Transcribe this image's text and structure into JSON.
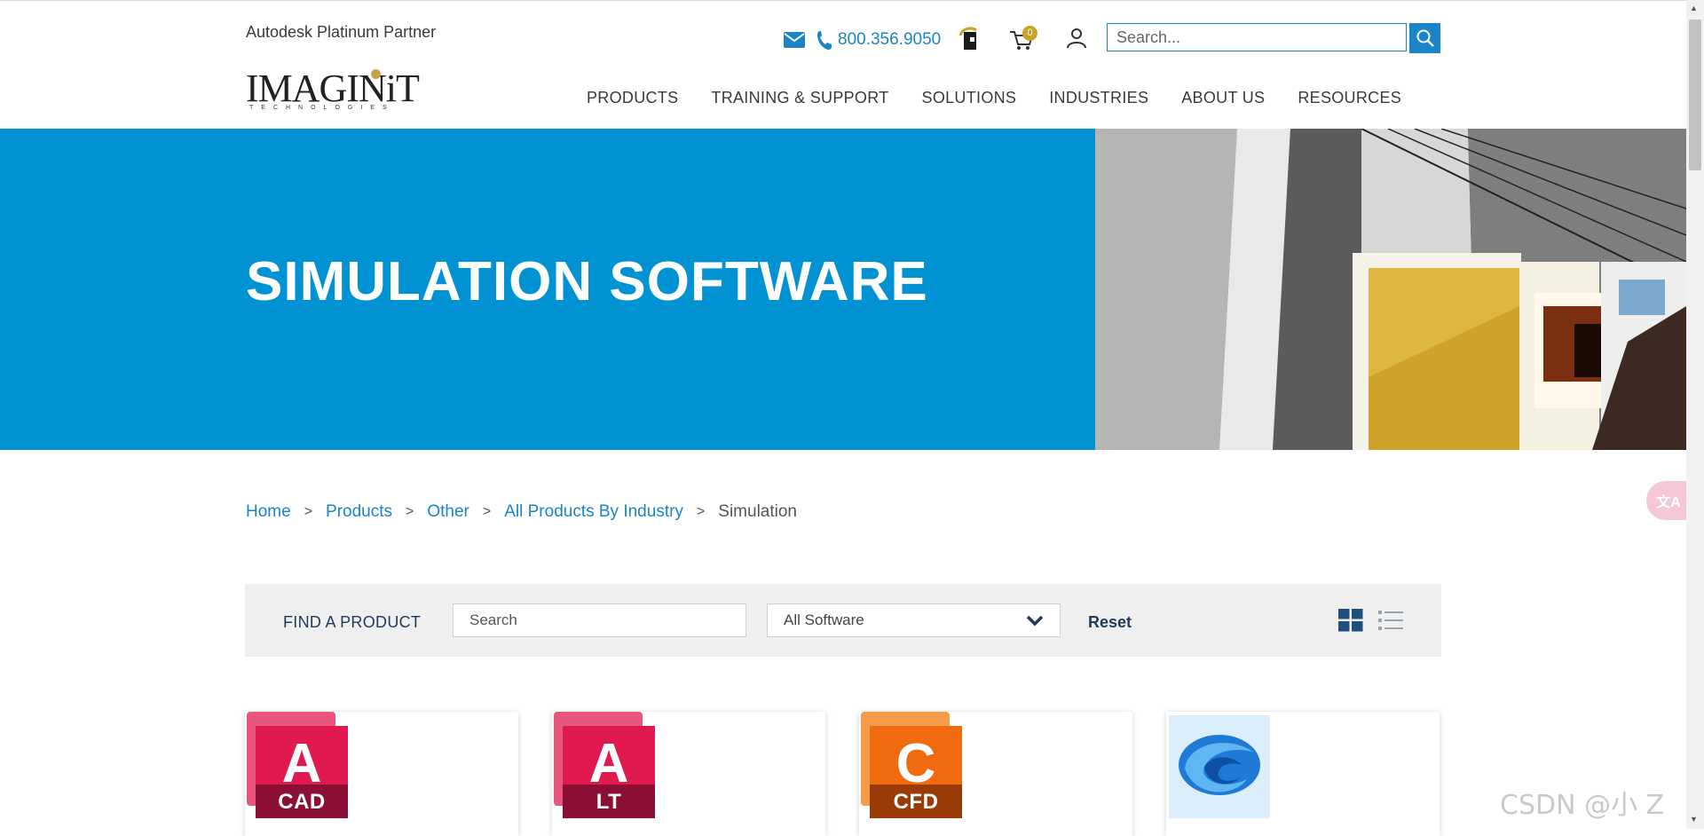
{
  "header": {
    "partner_text": "Autodesk Platinum Partner",
    "logo_text": "IMAGINiT",
    "logo_subtext": "TECHNOLOGIES",
    "phone": "800.356.9050",
    "cart_count": "0",
    "search_placeholder": "Search..."
  },
  "nav": {
    "items": [
      {
        "label": "PRODUCTS"
      },
      {
        "label": "TRAINING & SUPPORT"
      },
      {
        "label": "SOLUTIONS"
      },
      {
        "label": "INDUSTRIES"
      },
      {
        "label": "ABOUT US"
      },
      {
        "label": "RESOURCES"
      }
    ]
  },
  "hero": {
    "title": "SIMULATION SOFTWARE",
    "background_color": "#0192d3"
  },
  "breadcrumb": {
    "items": [
      {
        "label": "Home"
      },
      {
        "label": "Products"
      },
      {
        "label": "Other"
      },
      {
        "label": "All Products By Industry"
      }
    ],
    "current": "Simulation"
  },
  "filter": {
    "label": "FIND A PRODUCT",
    "search_placeholder": "Search",
    "select_value": "All Software",
    "reset_label": "Reset"
  },
  "products": [
    {
      "letter": "A",
      "abbr": "CAD",
      "back_color": "#e8557d",
      "front_color": "#e0194f",
      "band_color": "#8b0f35"
    },
    {
      "letter": "A",
      "abbr": "LT",
      "back_color": "#e8557d",
      "front_color": "#e0194f",
      "band_color": "#8b0f35"
    },
    {
      "letter": "C",
      "abbr": "CFD",
      "back_color": "#f59b4a",
      "front_color": "#f06a10",
      "band_color": "#9a3a06"
    },
    {
      "icon": "swirl-logo-icon"
    }
  ],
  "watermark": "CSDN @小 Z",
  "colors": {
    "accent": "#1a84c7",
    "nav_text": "#3a3a3a",
    "filter_bg": "#efefef",
    "badge": "#c9a227"
  }
}
